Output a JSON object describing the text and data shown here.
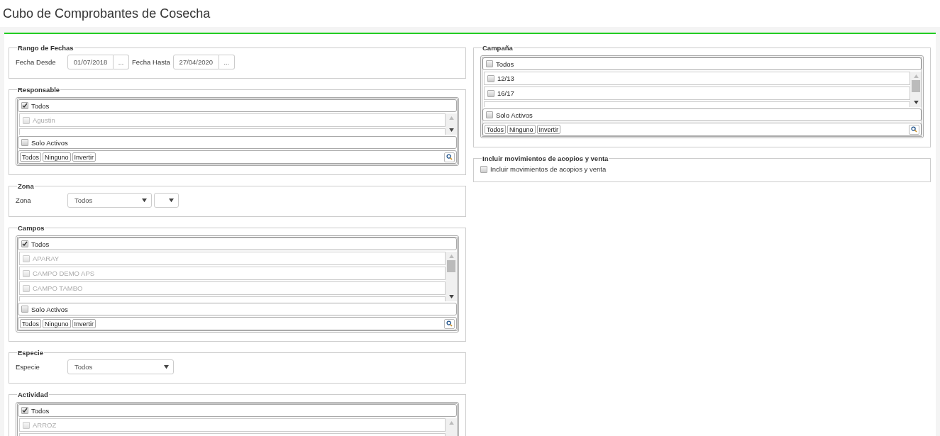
{
  "page": {
    "title": "Cubo de Comprobantes de Cosecha"
  },
  "left_column": [
    {
      "kind": "dates",
      "legend": "Rango de Fechas",
      "fields": [
        {
          "label": "Fecha Desde",
          "value": "01/07/2018",
          "button": "..."
        },
        {
          "label": "Fecha Hasta",
          "value": "27/04/2020",
          "button": "..."
        }
      ]
    },
    {
      "kind": "multiselect",
      "legend": "Responsable",
      "all": {
        "label": "Todos",
        "checked": true
      },
      "items": [
        {
          "label": "Agustin",
          "checked": false,
          "disabled": true
        }
      ],
      "active_only": {
        "label": "Solo Activos",
        "checked": false
      },
      "buttons": [
        "Todos",
        "Ninguno",
        "Invertir"
      ]
    },
    {
      "kind": "select",
      "legend": "Zona",
      "label": "Zona",
      "value": "Todos",
      "empty_select": true
    },
    {
      "kind": "multiselect",
      "legend": "Campos",
      "all": {
        "label": "Todos",
        "checked": true
      },
      "items": [
        {
          "label": "APARAY",
          "checked": false,
          "disabled": true
        },
        {
          "label": "CAMPO DEMO APS",
          "checked": false,
          "disabled": true
        },
        {
          "label": "CAMPO TAMBO",
          "checked": false,
          "disabled": true
        }
      ],
      "active_only": {
        "label": "Solo Activos",
        "checked": false
      },
      "buttons": [
        "Todos",
        "Ninguno",
        "Invertir"
      ]
    },
    {
      "kind": "select",
      "legend": "Especie",
      "label": "Especie",
      "value": "Todos",
      "empty_select": false
    },
    {
      "kind": "multiselect",
      "legend": "Actividad",
      "all": {
        "label": "Todos",
        "checked": true
      },
      "items": [
        {
          "label": "ARROZ",
          "checked": false,
          "disabled": true
        }
      ]
    }
  ],
  "right_column": [
    {
      "kind": "multiselect",
      "legend": "Campaña",
      "all": {
        "label": "Todos",
        "checked": false
      },
      "items": [
        {
          "label": "12/13",
          "checked": false,
          "disabled": false
        },
        {
          "label": "16/17",
          "checked": false,
          "disabled": false
        }
      ],
      "active_only": {
        "label": "Solo Activos",
        "checked": false
      },
      "buttons": [
        "Todos",
        "Ninguno",
        "Invertir"
      ]
    },
    {
      "kind": "checkbox",
      "legend": "Incluir movimientos de acopios y venta",
      "label": "Incluir movimientos de acopios y venta",
      "checked": false
    }
  ]
}
